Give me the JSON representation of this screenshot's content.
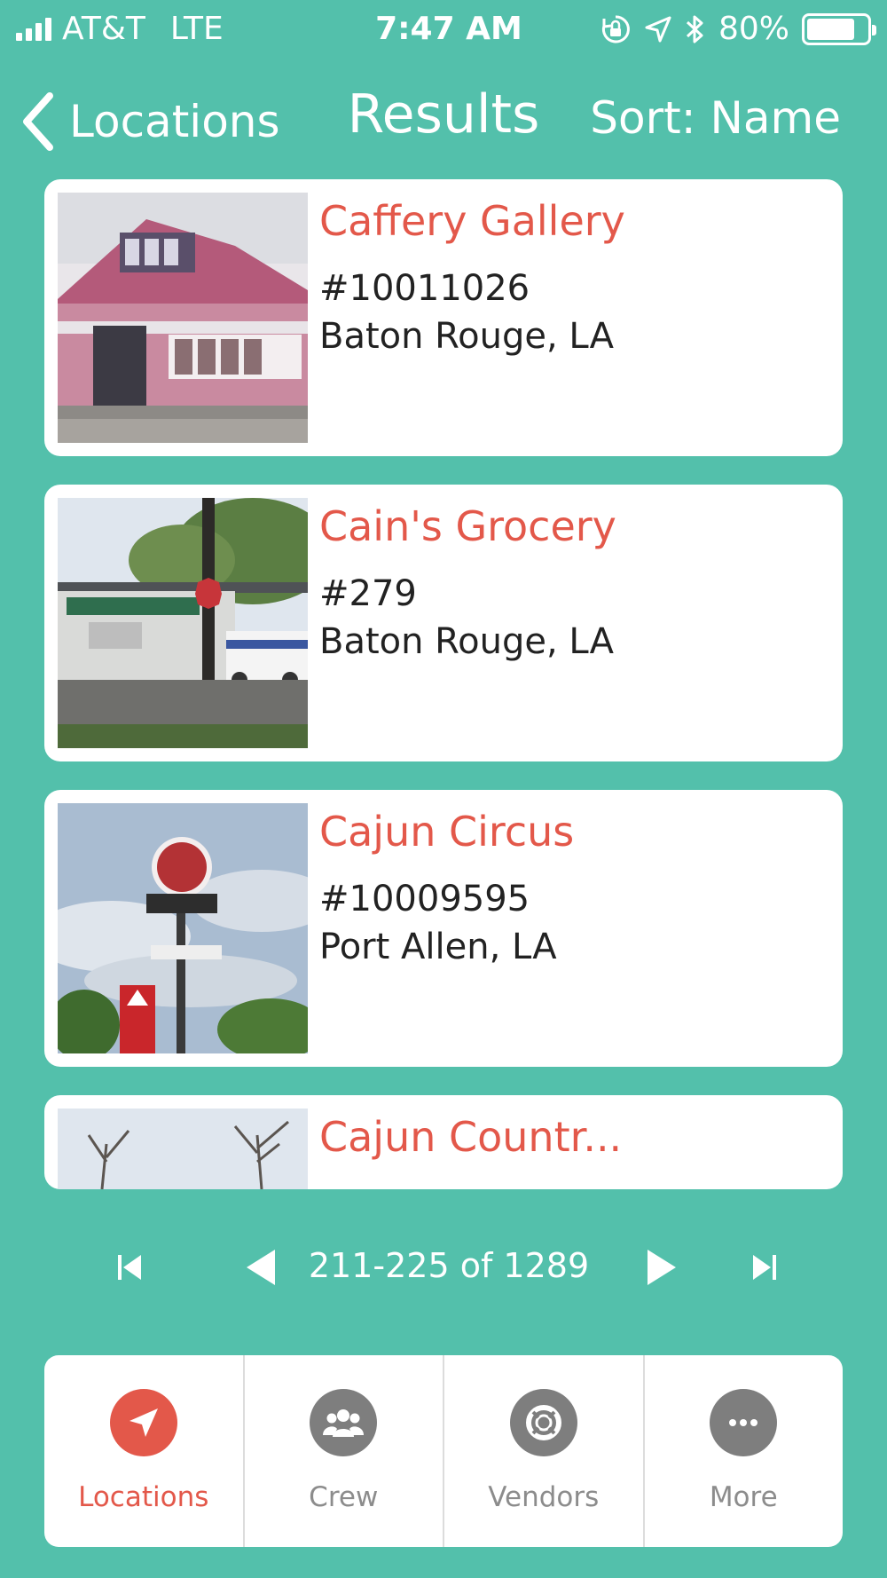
{
  "status_bar": {
    "carrier": "AT&T",
    "network": "LTE",
    "time": "7:47 AM",
    "battery": "80%",
    "battery_level": 0.8
  },
  "nav": {
    "back_label": "Locations",
    "title": "Results",
    "sort_label": "Sort: Name"
  },
  "results": [
    {
      "name": "Caffery Gallery",
      "id": "#10011026",
      "city": "Baton Rouge, LA"
    },
    {
      "name": "Cain's Grocery",
      "id": "#279",
      "city": "Baton Rouge, LA"
    },
    {
      "name": "Cajun Circus",
      "id": "#10009595",
      "city": "Port Allen, LA"
    },
    {
      "name": "Cajun Countr..."
    }
  ],
  "pager": {
    "status": "211-225 of 1289"
  },
  "tabs": [
    {
      "label": "Locations",
      "icon": "navigation-arrow-icon",
      "active": true
    },
    {
      "label": "Crew",
      "icon": "group-icon",
      "active": false
    },
    {
      "label": "Vendors",
      "icon": "lifebuoy-icon",
      "active": false
    },
    {
      "label": "More",
      "icon": "more-dots-icon",
      "active": false
    }
  ],
  "colors": {
    "background": "#53c0ab",
    "accent": "#e3584a",
    "inactive_icon": "#7e7e7e"
  }
}
